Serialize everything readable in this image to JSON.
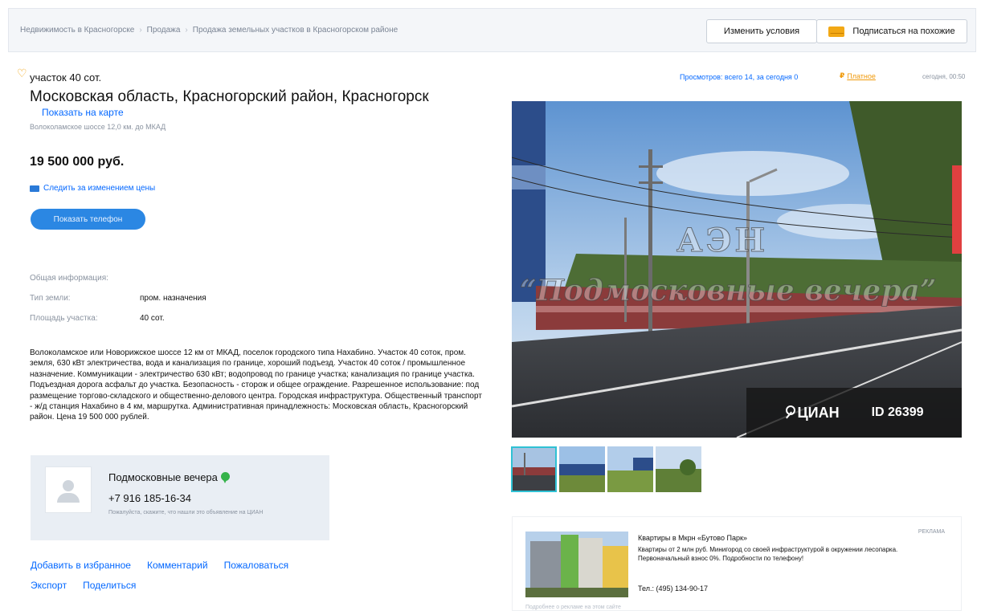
{
  "breadcrumbs": [
    "Недвижимость в Красногорске",
    "Продажа",
    "Продажа земельных участков в Красногорском районе"
  ],
  "breadcrumb_sep": "›",
  "header": {
    "change_conditions": "Изменить условия",
    "subscribe": "Подписаться на похожие"
  },
  "listing": {
    "subtitle": "участок 40 сот.",
    "address": "Московская область, Красногорский район, Красногорск",
    "show_on_map": "Показать на карте",
    "highway": "Волоколамское шоссе 12,0 км. до МКАД",
    "price": "19 500 000 руб.",
    "track_price": "Следить за изменением цены",
    "show_phone": "Показать телефон"
  },
  "general_info": {
    "title": "Общая информация:",
    "rows": [
      {
        "key": "Тип земли:",
        "value": "пром. назначения"
      },
      {
        "key": "Площадь участка:",
        "value": "40 сот."
      }
    ]
  },
  "description": "Волоколамское или Новорижское шоссе 12 км от МКАД, поселок городского типа Нахабино. Участок 40 соток, пром. земля, 630 кВт электричества, вода и канализация по границе, хороший подъезд. Участок 40 соток / промышленное назначение. Коммуникации - электричество 630 кВт; водопровод по границе участка; канализация по границе участка. Подъездная дорога асфальт до участка. Безопасность - сторож и общее ограждение. Разрешенное использование: под размещение торгово-складского и общественно-делового центра. Городская инфраструктура. Общественный транспорт - ж/д станция Нахабино в 4 км, маршрутка. Административная принадлежность: Московская область, Красногорский район. Цена 19 500 000 рублей.",
  "agent": {
    "name": "Подмосковные вечера",
    "phone": "+7 916 185-16-34",
    "note": "Пожалуйста, скажите, что нашли это объявление на ЦИАН"
  },
  "actions": {
    "row1": [
      "Добавить в избранное",
      "Комментарий",
      "Пожаловаться"
    ],
    "row2": [
      "Экспорт",
      "Поделиться"
    ]
  },
  "meta": {
    "views": "Просмотров: всего 14, за сегодня 0",
    "paid_symbol": "₽",
    "paid": "Платное",
    "time": "сегодня, 00:50"
  },
  "photo": {
    "watermark_top": "АЭН",
    "watermark_bottom": "“Подмосковные вечера”",
    "brand": "ЦИАН",
    "id": "ID 26399"
  },
  "ad": {
    "label": "РЕКЛАМА",
    "title": "Квартиры в Мкрн «Бутово Парк»",
    "text": "Квартиры от 2 млн руб. Минигород со своей инфраструктурой в окружении лесопарка. Первоначальный взнос 0%. Подробности по телефону!",
    "phone": "Тел.: (495) 134-90-17",
    "footer": "Подробнее о рекламе на этом сайте"
  },
  "colors": {
    "accent": "#0468ff",
    "button_blue": "#2b87e3",
    "paid": "#f09a0c",
    "agent_card_bg": "#e9eef4",
    "badge_green": "#35b34a"
  }
}
